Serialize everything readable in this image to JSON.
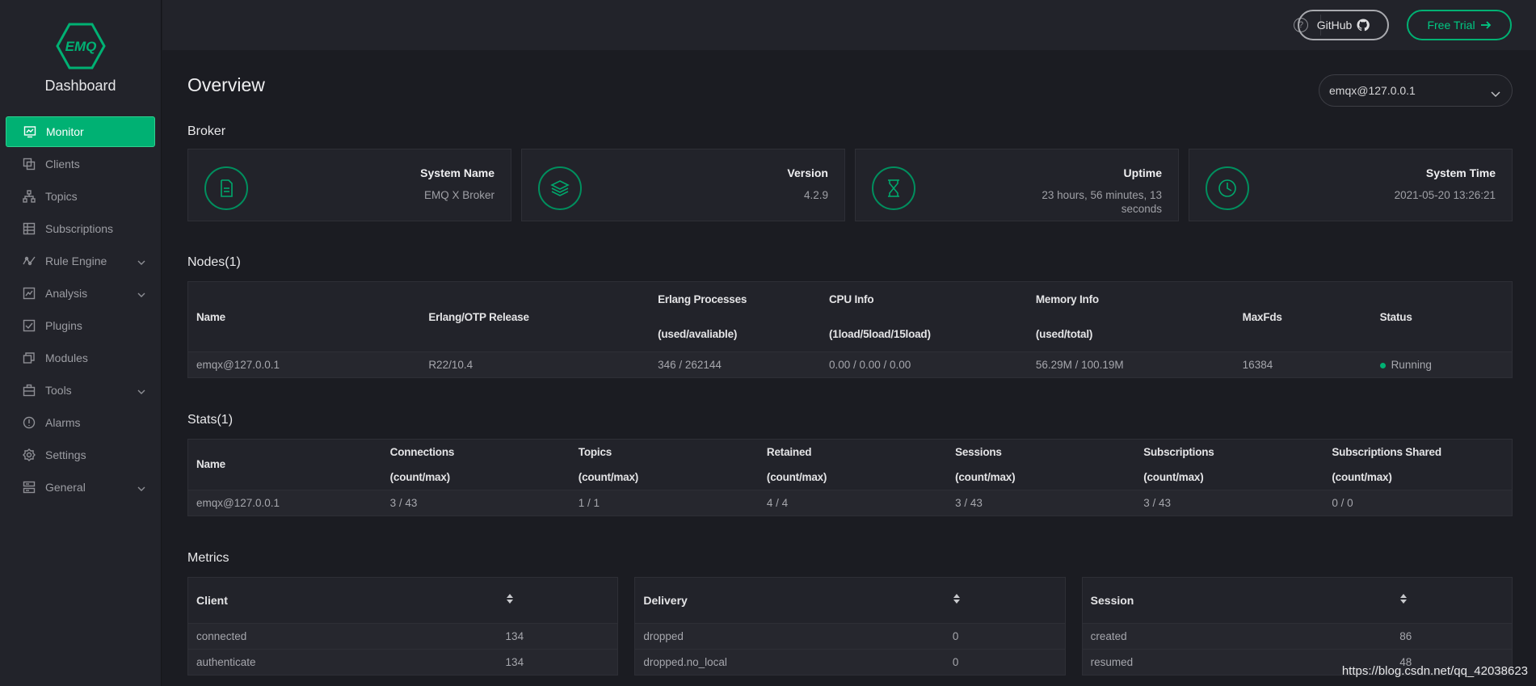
{
  "brand": {
    "logo_text": "EMQ",
    "title": "Dashboard",
    "accent": "#00b173"
  },
  "sidebar": {
    "items": [
      {
        "label": "Monitor",
        "icon": "monitor-icon",
        "active": true
      },
      {
        "label": "Clients",
        "icon": "clients-icon"
      },
      {
        "label": "Topics",
        "icon": "topics-icon"
      },
      {
        "label": "Subscriptions",
        "icon": "subscriptions-icon"
      },
      {
        "label": "Rule Engine",
        "icon": "rule-engine-icon",
        "expandable": true
      },
      {
        "label": "Analysis",
        "icon": "analysis-icon",
        "expandable": true
      },
      {
        "label": "Plugins",
        "icon": "plugins-icon"
      },
      {
        "label": "Modules",
        "icon": "modules-icon"
      },
      {
        "label": "Tools",
        "icon": "tools-icon",
        "expandable": true
      },
      {
        "label": "Alarms",
        "icon": "alarms-icon"
      },
      {
        "label": "Settings",
        "icon": "settings-icon"
      },
      {
        "label": "General",
        "icon": "general-icon",
        "expandable": true
      }
    ]
  },
  "header": {
    "help": "?",
    "github_label": "GitHub",
    "trial_label": "Free Trial"
  },
  "main": {
    "title": "Overview",
    "node_select": "emqx@127.0.0.1",
    "broker": {
      "heading": "Broker",
      "cards": [
        {
          "title": "System Name",
          "value": "EMQ X Broker",
          "icon": "file-icon"
        },
        {
          "title": "Version",
          "value": "4.2.9",
          "icon": "layers-icon"
        },
        {
          "title": "Uptime",
          "value": "23 hours, 56 minutes, 13 seconds",
          "icon": "hourglass-icon"
        },
        {
          "title": "System Time",
          "value": "2021-05-20 13:26:21",
          "icon": "clock-icon"
        }
      ]
    },
    "nodes": {
      "heading": "Nodes(1)",
      "columns": [
        "Name",
        "Erlang/OTP Release",
        "Erlang Processes",
        "(used/avaliable)",
        "CPU Info",
        "(1load/5load/15load)",
        "Memory Info",
        "(used/total)",
        "MaxFds",
        "Status"
      ],
      "row": {
        "name": "emqx@127.0.0.1",
        "otp": "R22/10.4",
        "processes": "346 / 262144",
        "cpu": "0.00 / 0.00 / 0.00",
        "memory": "56.29M / 100.19M",
        "maxfds": "16384",
        "status": "Running"
      }
    },
    "stats": {
      "heading": "Stats(1)",
      "columns": [
        "Name",
        "Connections",
        "Topics",
        "Retained",
        "Sessions",
        "Subscriptions",
        "Subscriptions Shared"
      ],
      "subheader": "(count/max)",
      "row": {
        "name": "emqx@127.0.0.1",
        "connections": "3 / 43",
        "topics": "1 / 1",
        "retained": "4 / 4",
        "sessions": "3 / 43",
        "subscriptions": "3 / 43",
        "shared": "0 / 0"
      }
    },
    "metrics": {
      "heading": "Metrics",
      "client": {
        "title": "Client",
        "rows": [
          {
            "k": "connected",
            "v": "134"
          },
          {
            "k": "authenticate",
            "v": "134"
          }
        ]
      },
      "delivery": {
        "title": "Delivery",
        "rows": [
          {
            "k": "dropped",
            "v": "0"
          },
          {
            "k": "dropped.no_local",
            "v": "0"
          }
        ]
      },
      "session": {
        "title": "Session",
        "rows": [
          {
            "k": "created",
            "v": "86"
          },
          {
            "k": "resumed",
            "v": "48"
          }
        ]
      }
    }
  },
  "watermark": "https://blog.csdn.net/qq_42038623"
}
